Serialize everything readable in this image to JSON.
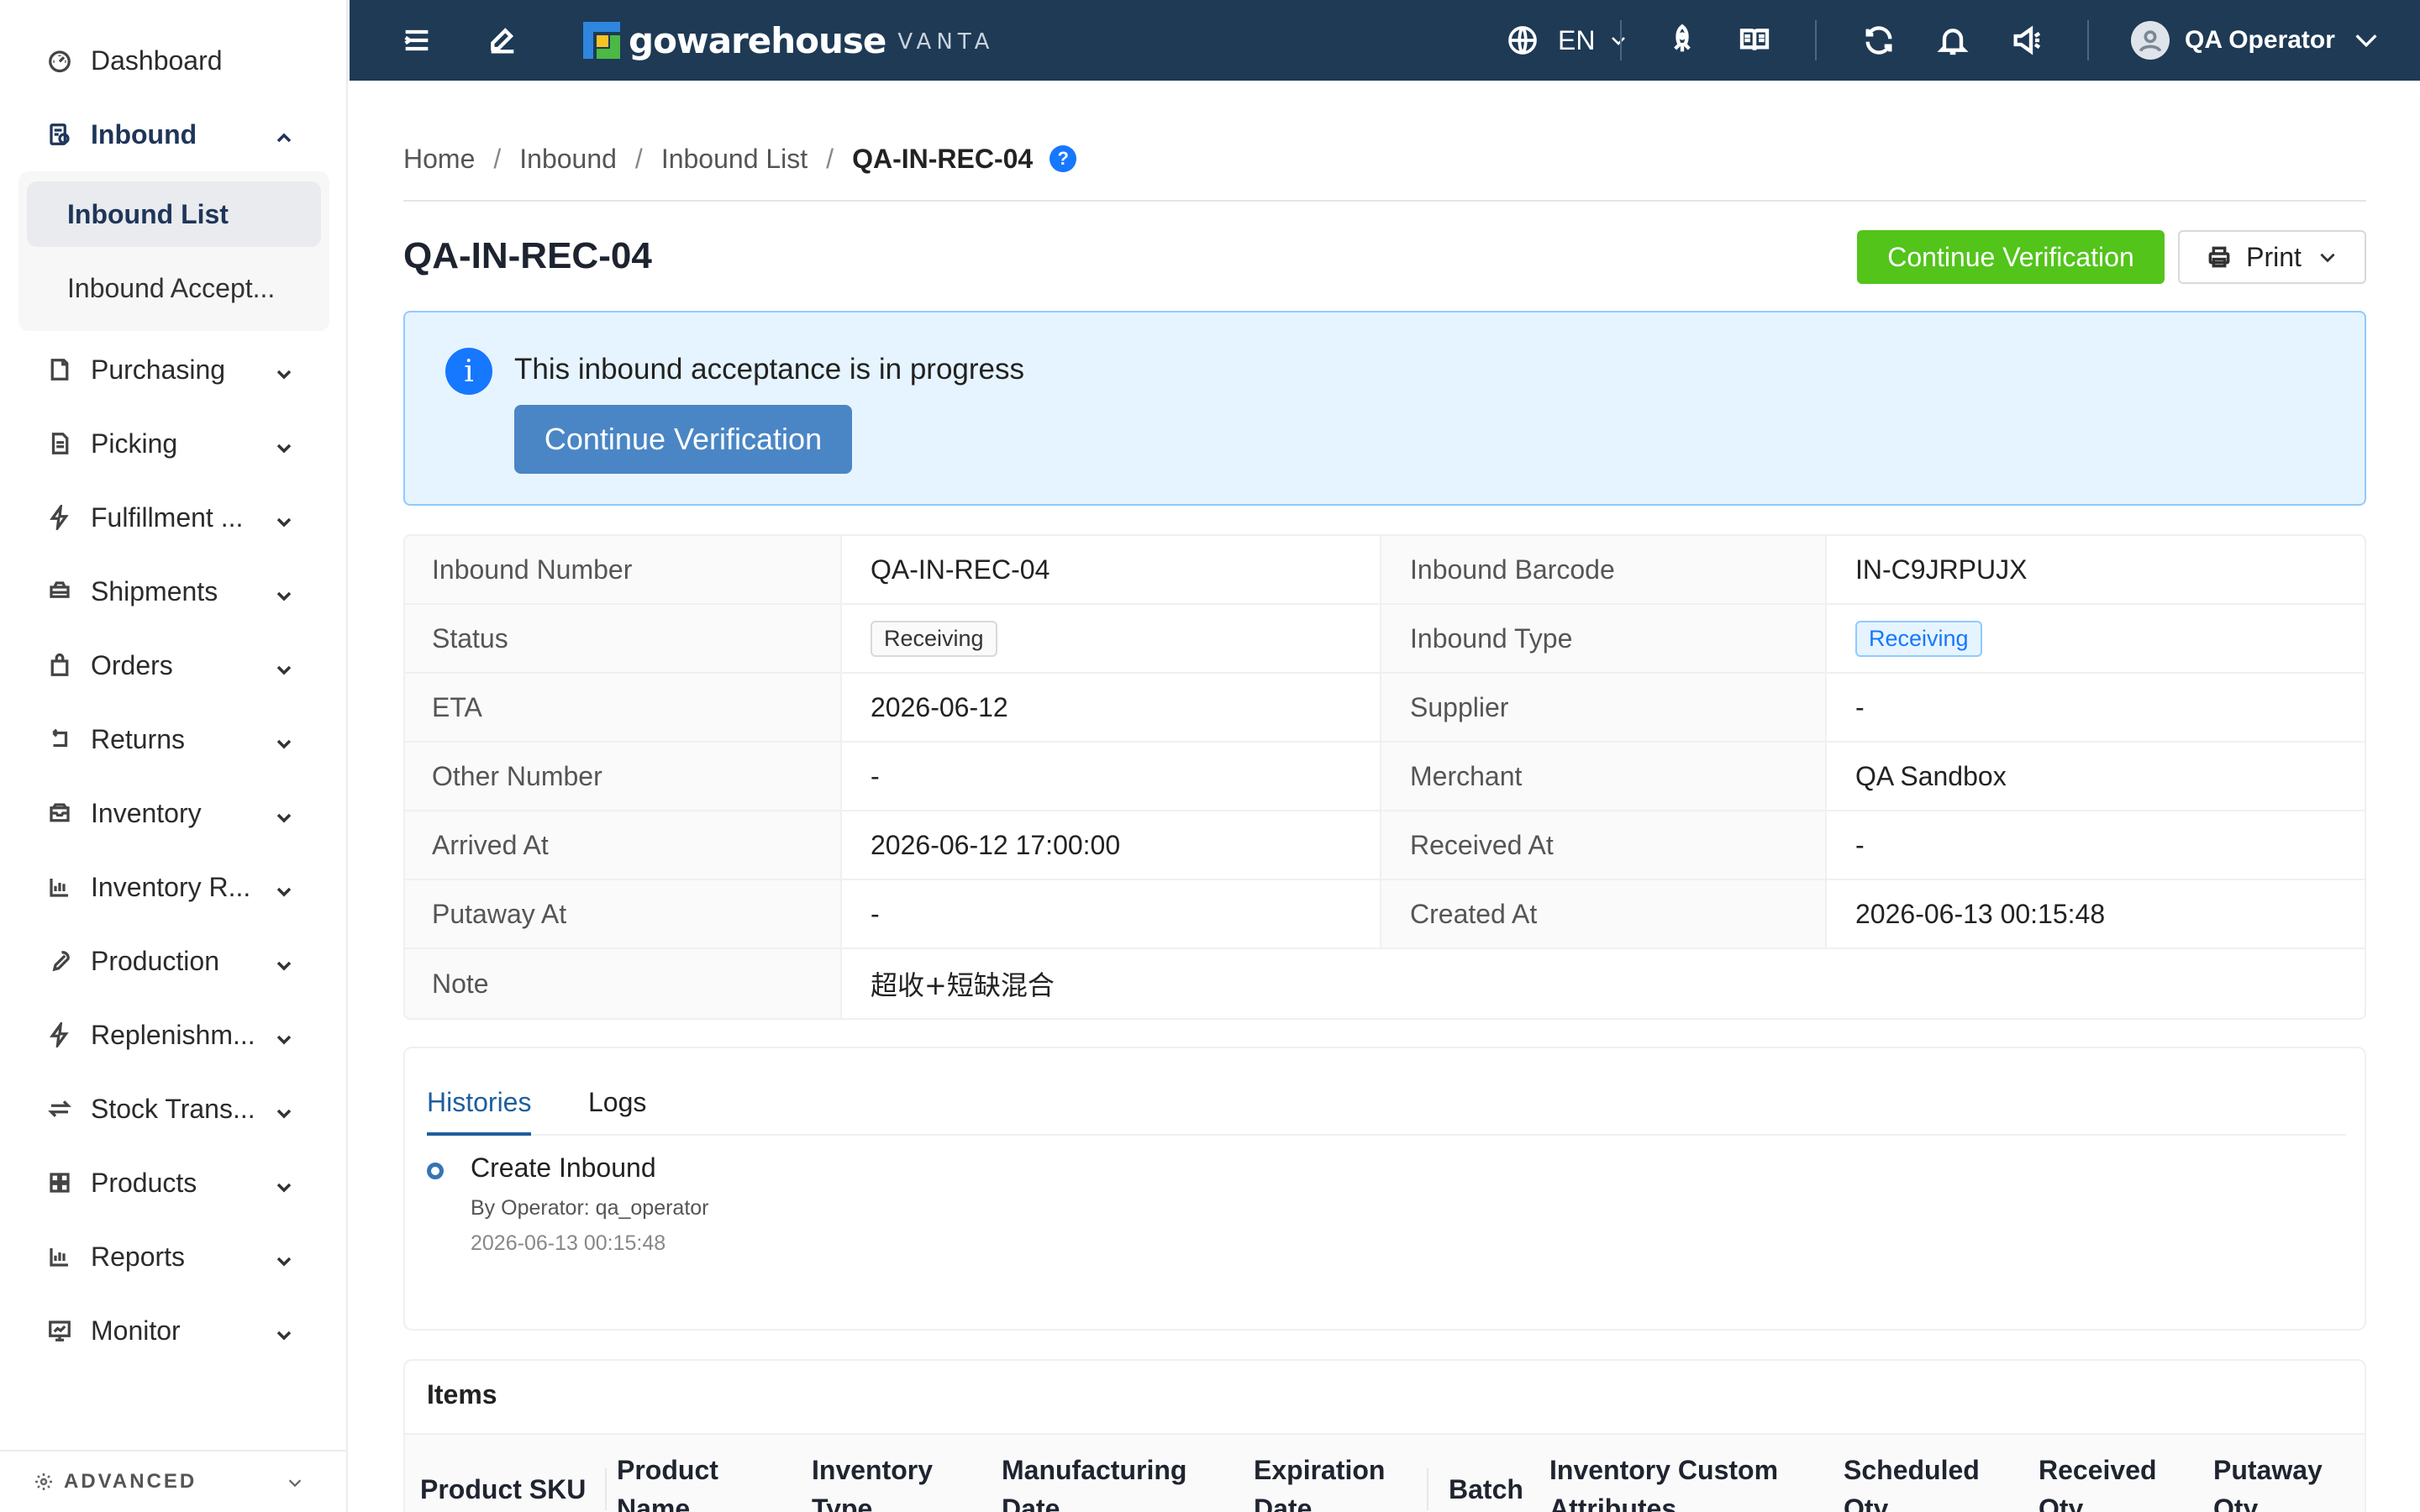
{
  "sidebar": {
    "items": [
      {
        "label": "Dashboard",
        "icon": "dashboard-icon"
      },
      {
        "label": "Inbound",
        "icon": "inbound-icon",
        "expanded": true
      },
      {
        "label": "Purchasing",
        "icon": "purchasing-icon"
      },
      {
        "label": "Picking",
        "icon": "picking-icon"
      },
      {
        "label": "Fulfillment ...",
        "icon": "fulfillment-icon"
      },
      {
        "label": "Shipments",
        "icon": "shipments-icon"
      },
      {
        "label": "Orders",
        "icon": "orders-icon"
      },
      {
        "label": "Returns",
        "icon": "returns-icon"
      },
      {
        "label": "Inventory",
        "icon": "inventory-icon"
      },
      {
        "label": "Inventory R...",
        "icon": "inventory-report-icon"
      },
      {
        "label": "Production",
        "icon": "production-icon"
      },
      {
        "label": "Replenishm...",
        "icon": "replenishment-icon"
      },
      {
        "label": "Stock Trans...",
        "icon": "stock-transfer-icon"
      },
      {
        "label": "Products",
        "icon": "products-icon"
      },
      {
        "label": "Reports",
        "icon": "reports-icon"
      },
      {
        "label": "Monitor",
        "icon": "monitor-icon"
      }
    ],
    "submenu": [
      {
        "label": "Inbound List",
        "active": true
      },
      {
        "label": "Inbound Accept..."
      }
    ],
    "advanced_label": "ADVANCED"
  },
  "header": {
    "logo_text": "gowarehouse",
    "logo_sub": "VANTA",
    "language": "EN",
    "user_name": "QA Operator",
    "bg_color": "#1e3a55"
  },
  "breadcrumb": [
    "Home",
    "Inbound",
    "Inbound List",
    "QA-IN-REC-04"
  ],
  "page": {
    "title": "QA-IN-REC-04",
    "primary_action": "Continue Verification",
    "print_label": "Print",
    "accent_green": "#52c41a"
  },
  "alert": {
    "message": "This inbound acceptance is in progress",
    "button": "Continue Verification"
  },
  "details": {
    "inbound_number_label": "Inbound Number",
    "inbound_number": "QA-IN-REC-04",
    "inbound_barcode_label": "Inbound Barcode",
    "inbound_barcode": "IN-C9JRPUJX",
    "status_label": "Status",
    "status": "Receiving",
    "inbound_type_label": "Inbound Type",
    "inbound_type": "Receiving",
    "eta_label": "ETA",
    "eta": "2026-06-12",
    "supplier_label": "Supplier",
    "supplier": "-",
    "other_number_label": "Other Number",
    "other_number": "-",
    "merchant_label": "Merchant",
    "merchant": "QA Sandbox",
    "arrived_at_label": "Arrived At",
    "arrived_at": "2026-06-12 17:00:00",
    "received_at_label": "Received At",
    "received_at": "-",
    "putaway_at_label": "Putaway At",
    "putaway_at": "-",
    "created_at_label": "Created At",
    "created_at": "2026-06-13 00:15:48",
    "note_label": "Note",
    "note": "超收+短缺混合"
  },
  "history": {
    "tabs": [
      "Histories",
      "Logs"
    ],
    "active_tab": "Histories",
    "entries": [
      {
        "title": "Create Inbound",
        "operator": "By Operator: qa_operator",
        "time": "2026-06-13 00:15:48"
      }
    ]
  },
  "items": {
    "title": "Items",
    "columns": [
      [
        "Product SKU"
      ],
      [
        "Product",
        "Name"
      ],
      [
        "Inventory",
        "Type"
      ],
      [
        "Manufacturing",
        "Date"
      ],
      [
        "Expiration",
        "Date"
      ],
      [
        "Batch"
      ],
      [
        "Inventory Custom",
        "Attributes"
      ],
      [
        "Scheduled",
        "Qty"
      ],
      [
        "Received",
        "Qty"
      ],
      [
        "Putaway",
        "Qty"
      ]
    ]
  }
}
